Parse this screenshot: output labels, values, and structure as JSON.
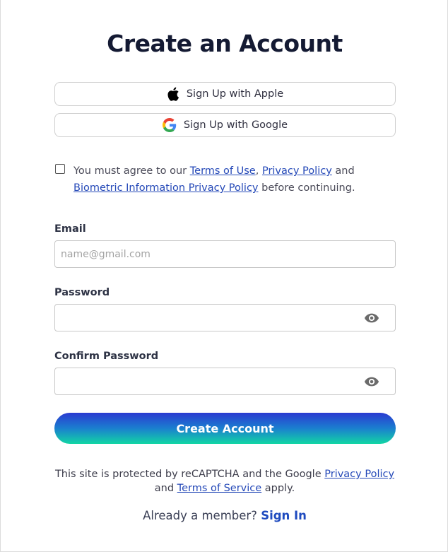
{
  "page": {
    "title": "Create an Account"
  },
  "social": {
    "apple_label": "Sign Up with Apple",
    "google_label": "Sign Up with Google"
  },
  "agreement": {
    "prefix": "You must agree to our ",
    "terms_link": "Terms of Use",
    "sep": ",",
    "privacy_link": "Privacy Policy",
    "and": " and",
    "biometric_link": "Biometric Information Privacy Policy",
    "suffix": " before continuing."
  },
  "form": {
    "email_label": "Email",
    "email_placeholder": "name@gmail.com",
    "email_value": "",
    "password_label": "Password",
    "password_value": "",
    "confirm_label": "Confirm Password",
    "confirm_value": "",
    "submit_label": "Create Account"
  },
  "footer": {
    "recaptcha_prefix": "This site is protected by reCAPTCHA and the Google ",
    "privacy_link": "Privacy Policy",
    "and": "and ",
    "terms_link": "Terms of Service",
    "suffix": " apply.",
    "member_prompt": "Already a member? ",
    "signin_link": "Sign In"
  },
  "icons": {
    "apple": "apple-icon",
    "google": "google-icon",
    "eye": "eye-icon"
  },
  "colors": {
    "link": "#2549b8",
    "gradient_top": "#2a3ad1",
    "gradient_bottom": "#12d6a4"
  }
}
